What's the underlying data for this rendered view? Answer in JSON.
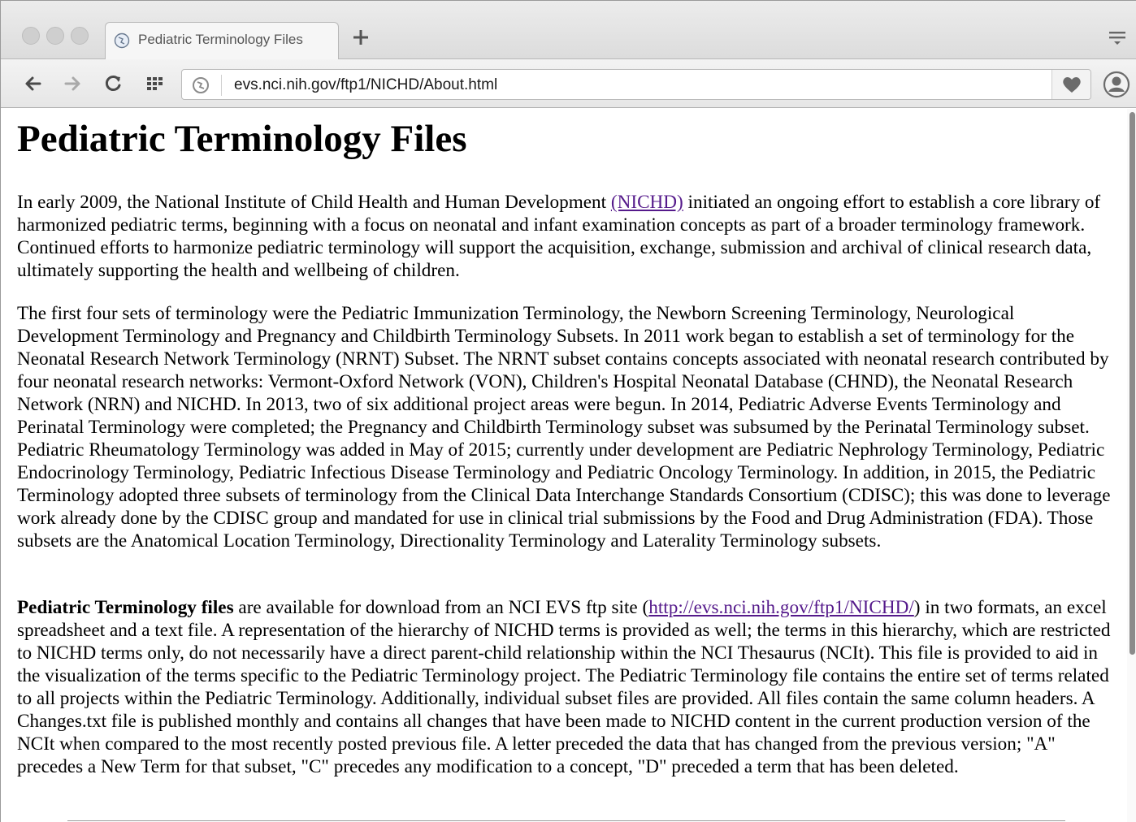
{
  "browser": {
    "tab": {
      "title": "Pediatric Terminology Files",
      "favicon": "globe-icon"
    },
    "new_tab_label": "+",
    "url": "evs.nci.nih.gov/ftp1/NICHD/About.html",
    "icons": {
      "back": "back-arrow-icon",
      "forward": "forward-arrow-icon",
      "reload": "reload-icon",
      "apps": "apps-grid-icon",
      "site": "site-info-icon",
      "bookmark": "heart-icon",
      "account": "account-icon",
      "tab_menu": "tab-menu-icon"
    }
  },
  "page": {
    "title": "Pediatric Terminology Files",
    "para1": {
      "before_link": "In early 2009, the National Institute of Child Health and Human Development ",
      "link_text": " (NICHD)",
      "after_link": " initiated an ongoing effort to establish a core library of harmonized pediatric terms, beginning with a focus on neonatal and infant examination concepts as part of a broader terminology framework. Continued efforts to harmonize pediatric terminology will support the acquisition, exchange, submission and archival of clinical research data, ultimately supporting the health and wellbeing of children."
    },
    "para2": "The first four sets of terminology were the Pediatric Immunization Terminology, the Newborn Screening Terminology, Neurological Development Terminology and Pregnancy and Childbirth Terminology Subsets. In 2011 work began to establish a set of terminology for the Neonatal Research Network Terminology (NRNT) Subset. The NRNT subset contains concepts associated with neonatal research contributed by four neonatal research networks: Vermont-Oxford Network (VON), Children's Hospital Neonatal Database (CHND), the Neonatal Research Network (NRN) and NICHD. In 2013, two of six additional project areas were begun. In 2014, Pediatric Adverse Events Terminology and Perinatal Terminology were completed; the Pregnancy and Childbirth Terminology subset was subsumed by the Perinatal Terminology subset. Pediatric Rheumatology Terminology was added in May of 2015; currently under development are Pediatric Nephrology Terminology, Pediatric Endocrinology Terminology, Pediatric Infectious Disease Terminology and Pediatric Oncology Terminology. In addition, in 2015, the Pediatric Terminology adopted three subsets of terminology from the Clinical Data Interchange Standards Consortium (CDISC); this was done to leverage work already done by the CDISC group and mandated for use in clinical trial submissions by the Food and Drug Administration (FDA). Those subsets are the Anatomical Location Terminology, Directionality Terminology and Laterality Terminology subsets.",
    "para3": {
      "bold_lead": "Pediatric Terminology files",
      "before_link": " are available for download from an NCI EVS ftp site (",
      "link_text": "http://evs.nci.nih.gov/ftp1/NICHD/",
      "after_link": ")  in two formats, an excel spreadsheet and a text file. A representation of the hierarchy of NICHD terms is provided as well; the terms in this hierarchy, which are restricted to NICHD terms only, do not necessarily have a direct parent-child relationship within the NCI Thesaurus (NCIt). This file is provided to aid in the visualization of the terms specific to the Pediatric Terminology project. The Pediatric Terminology file contains the entire set of terms related to all projects within the Pediatric Terminology. Additionally, individual subset files are provided. All files contain the same column headers. A Changes.txt file is published monthly and contains all changes that have been made to NICHD content in the current production version of the NCIt when compared to the most recently posted previous file. A letter preceded the data that has changed from the previous version; \"A\" precedes a New Term for that subset, \"C\" precedes any modification to a concept, \"D\" preceded a term that has been deleted."
    }
  },
  "colors": {
    "link_visited": "#551a8b",
    "chrome_bg": "#e6e6e6",
    "scroll_thumb": "#8b8b8b"
  }
}
